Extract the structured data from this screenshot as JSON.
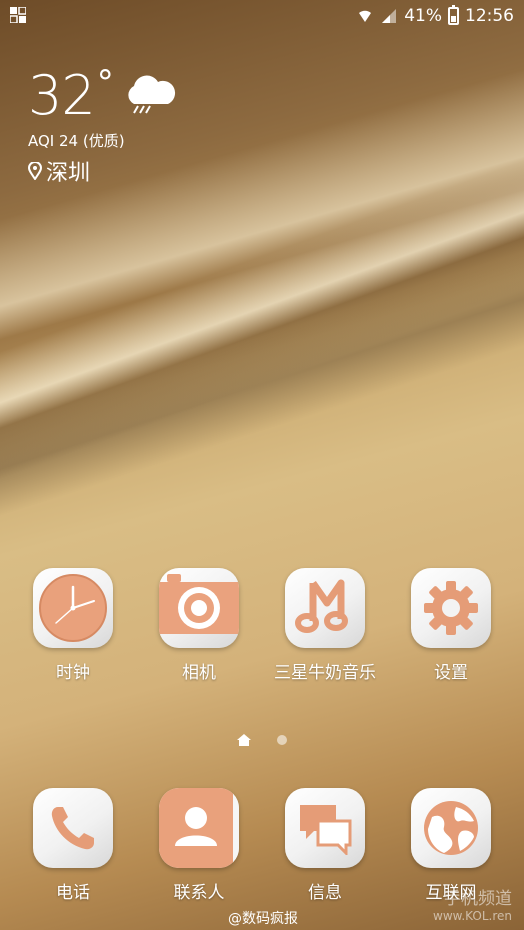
{
  "status_bar": {
    "battery": "41%",
    "time": "12:56"
  },
  "weather": {
    "temperature": "32",
    "degree_symbol": "°",
    "aqi": "AQI 24 (优质)",
    "city": "深圳"
  },
  "apps": [
    {
      "label": "时钟",
      "icon": "clock-icon"
    },
    {
      "label": "相机",
      "icon": "camera-icon"
    },
    {
      "label": "三星牛奶音乐",
      "icon": "music-icon"
    },
    {
      "label": "设置",
      "icon": "gear-icon"
    }
  ],
  "dock": [
    {
      "label": "电话",
      "icon": "phone-icon"
    },
    {
      "label": "联系人",
      "icon": "contacts-icon"
    },
    {
      "label": "信息",
      "icon": "messages-icon"
    },
    {
      "label": "互联网",
      "icon": "globe-icon"
    }
  ],
  "pager": {
    "pages": 2,
    "current": 1
  },
  "watermark": {
    "weibo": "@数码疯报",
    "site_name": "手机频道",
    "site_url": "www.KOL.ren"
  },
  "colors": {
    "accent": "#e8a07c",
    "accent_dark": "#d98a66",
    "tile_light": "#ffffff"
  }
}
